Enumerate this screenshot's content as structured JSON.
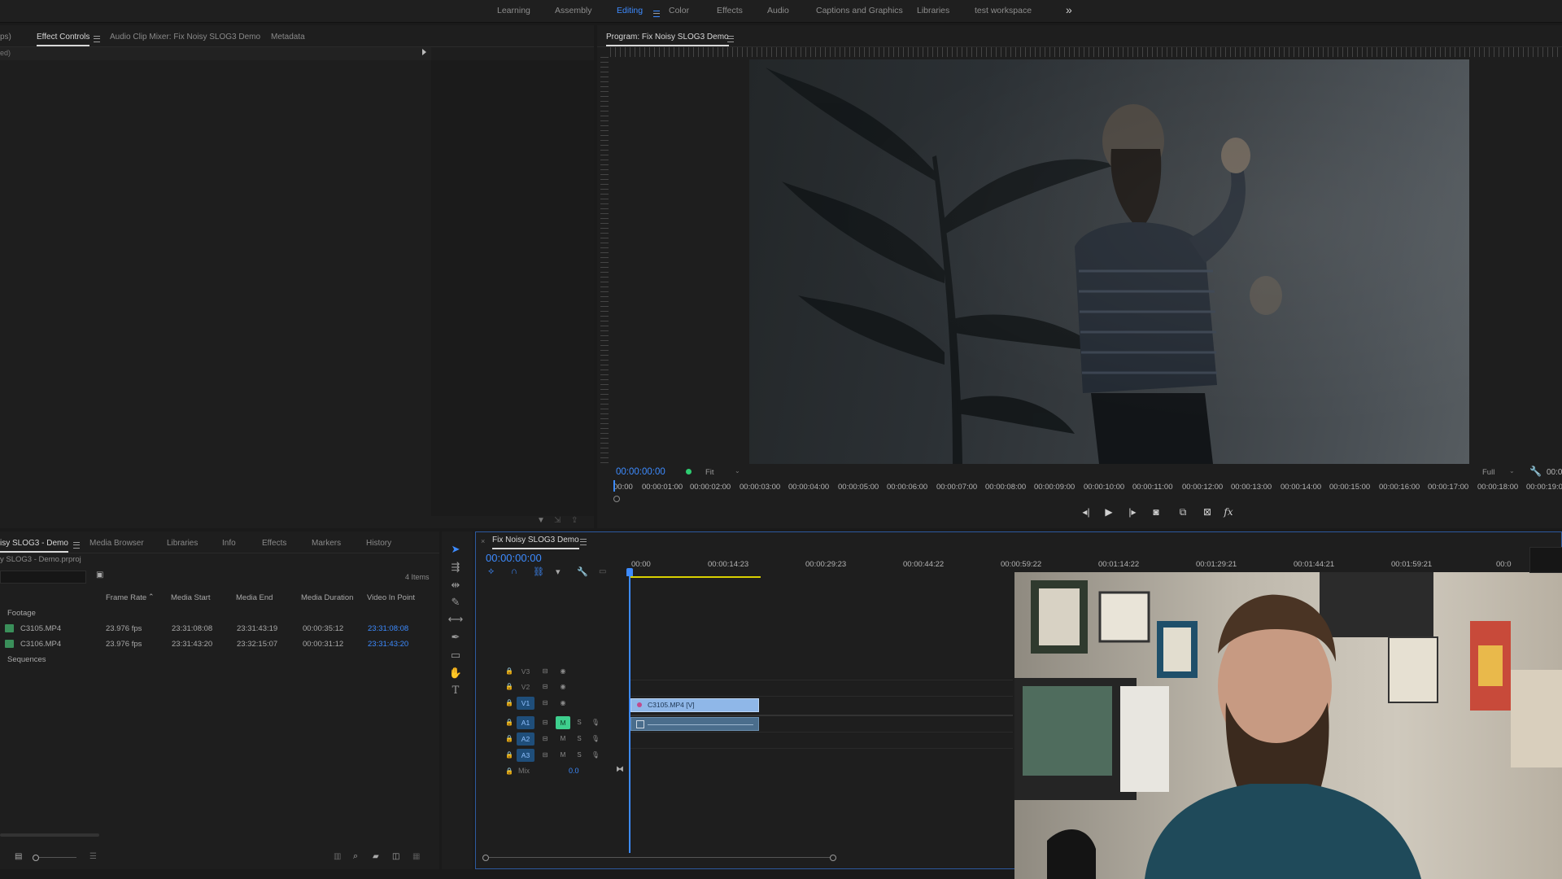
{
  "workspaces": [
    "Learning",
    "Assembly",
    "Editing",
    "Color",
    "Effects",
    "Audio",
    "Captions and Graphics",
    "Libraries",
    "test workspace"
  ],
  "active_workspace": "Editing",
  "more_glyph": "»",
  "source_panel": {
    "cut_left_label": "ps)",
    "cut_left_sub": "ed)",
    "tabs": [
      "Effect Controls",
      "Audio Clip Mixer: Fix Noisy SLOG3 Demo",
      "Metadata"
    ]
  },
  "program": {
    "title": "Program: Fix Noisy SLOG3 Demo",
    "timecode": "00:00:00:00",
    "fit": "Fit",
    "resolution": "Full",
    "ruler_labels": [
      "00:00",
      "00:00:01:00",
      "00:00:02:00",
      "00:00:03:00",
      "00:00:04:00",
      "00:00:05:00",
      "00:00:06:00",
      "00:00:07:00",
      "00:00:08:00",
      "00:00:09:00",
      "00:00:10:00",
      "00:00:11:00",
      "00:00:12:00",
      "00:00:13:00",
      "00:00:14:00",
      "00:00:15:00",
      "00:00:16:00",
      "00:00:17:00",
      "00:00:18:00",
      "00:00:19:0"
    ],
    "cut_tc": "00:0",
    "fx_label": "fx"
  },
  "project": {
    "tabs": [
      "isy SLOG3 - Demo",
      "Media Browser",
      "Libraries",
      "Info",
      "Effects",
      "Markers",
      "History"
    ],
    "file": "y SLOG3 - Demo.prproj",
    "items_count": "4 Items",
    "columns": [
      "Frame Rate",
      "Media Start",
      "Media End",
      "Media Duration",
      "Video In Point"
    ],
    "folder_footage": "Footage",
    "rows": [
      {
        "name": "C3105.MP4",
        "fps": "23.976 fps",
        "start": "23:31:08:08",
        "end": "23:31:43:19",
        "dur": "00:00:35:12",
        "in": "23:31:08:08"
      },
      {
        "name": "C3106.MP4",
        "fps": "23.976 fps",
        "start": "23:31:43:20",
        "end": "23:32:15:07",
        "dur": "00:00:31:12",
        "in": "23:31:43:20"
      }
    ],
    "folder_sequences": "Sequences"
  },
  "timeline": {
    "title": "Fix Noisy SLOG3 Demo",
    "timecode": "00:00:00:00",
    "ruler": [
      "00:00",
      "00:00:14:23",
      "00:00:29:23",
      "00:00:44:22",
      "00:00:59:22",
      "00:01:14:22",
      "00:01:29:21",
      "00:01:44:21",
      "00:01:59:21",
      "00:0"
    ],
    "video_tracks": [
      "V3",
      "V2",
      "V1"
    ],
    "audio_tracks": [
      "A1",
      "A2",
      "A3"
    ],
    "mix_label": "Mix",
    "mix_value": "0.0",
    "clip_label": "C3105.MP4 [V]",
    "btn_m": "M",
    "btn_s": "S"
  },
  "colors": {
    "accent": "#3d8bff",
    "clip_video": "#8fb7e8",
    "clip_audio": "#4a6d8c",
    "playhead": "#3d8bff",
    "mute_green": "#3ecf8e"
  }
}
